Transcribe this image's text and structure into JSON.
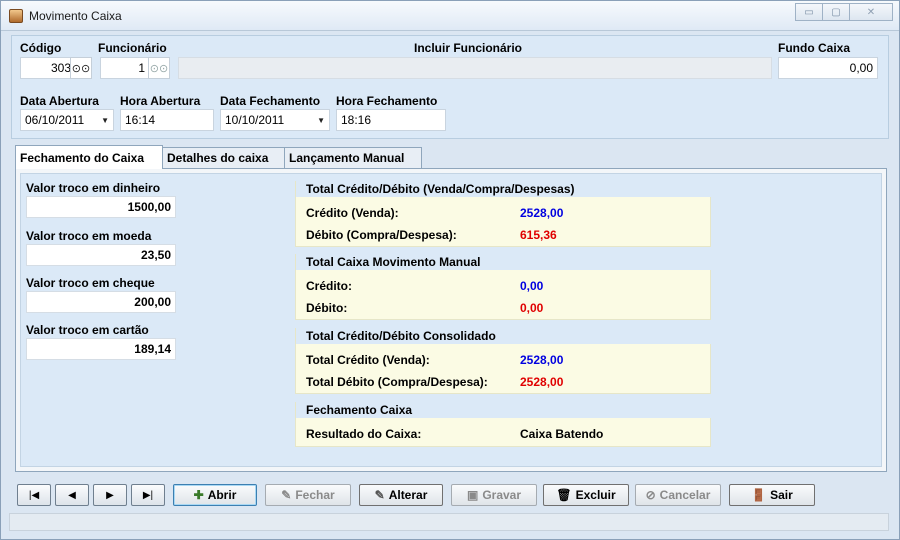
{
  "window": {
    "title": "Movimento Caixa",
    "controls": {
      "minimize": "▭",
      "maximize": "▢",
      "close": "✕"
    }
  },
  "header": {
    "codigo_label": "Código",
    "codigo_value": "303",
    "funcionario_label": "Funcionário",
    "funcionario_value": "1",
    "incluir_label": "Incluir Funcionário",
    "fundo_label": "Fundo Caixa",
    "fundo_value": "0,00",
    "data_abertura_label": "Data Abertura",
    "data_abertura_value": "06/10/2011",
    "hora_abertura_label": "Hora Abertura",
    "hora_abertura_value": "16:14",
    "data_fechamento_label": "Data Fechamento",
    "data_fechamento_value": "10/10/2011",
    "hora_fechamento_label": "Hora Fechamento",
    "hora_fechamento_value": "18:16"
  },
  "tabs": [
    {
      "label": "Fechamento do Caixa"
    },
    {
      "label": "Detalhes do caixa"
    },
    {
      "label": "Lançamento Manual"
    }
  ],
  "troco": {
    "dinheiro_label": "Valor troco em dinheiro",
    "dinheiro_value": "1500,00",
    "moeda_label": "Valor troco em moeda",
    "moeda_value": "23,50",
    "cheque_label": "Valor troco em cheque",
    "cheque_value": "200,00",
    "cartao_label": "Valor troco em cartão",
    "cartao_value": "189,14"
  },
  "groups": {
    "total": {
      "title": "Total Crédito/Débito (Venda/Compra/Despesas)",
      "credito_label": "Crédito (Venda):",
      "credito_value": "2528,00",
      "debito_label": "Débito (Compra/Despesa):",
      "debito_value": "615,36"
    },
    "manual": {
      "title": "Total Caixa Movimento Manual",
      "credito_label": "Crédito:",
      "credito_value": "0,00",
      "debito_label": "Débito:",
      "debito_value": "0,00"
    },
    "consolidado": {
      "title": "Total Crédito/Débito Consolidado",
      "credito_label": "Total Crédito (Venda):",
      "credito_value": "2528,00",
      "debito_label": "Total Débito (Compra/Despesa):",
      "debito_value": "2528,00"
    },
    "fechamento": {
      "title": "Fechamento Caixa",
      "resultado_label": "Resultado do Caixa:",
      "resultado_value": "Caixa Batendo"
    }
  },
  "nav": {
    "first": "|◀",
    "prev": "◀",
    "next": "▶",
    "last": "▶|"
  },
  "actions": {
    "abrir": "Abrir",
    "fechar": "Fechar",
    "alterar": "Alterar",
    "gravar": "Gravar",
    "excluir": "Excluir",
    "cancelar": "Cancelar",
    "sair": "Sair"
  },
  "colors": {
    "credit": "#0000e0",
    "debit": "#e00000",
    "panel": "#dbe9f7",
    "group_bg": "#fbfbe4"
  }
}
